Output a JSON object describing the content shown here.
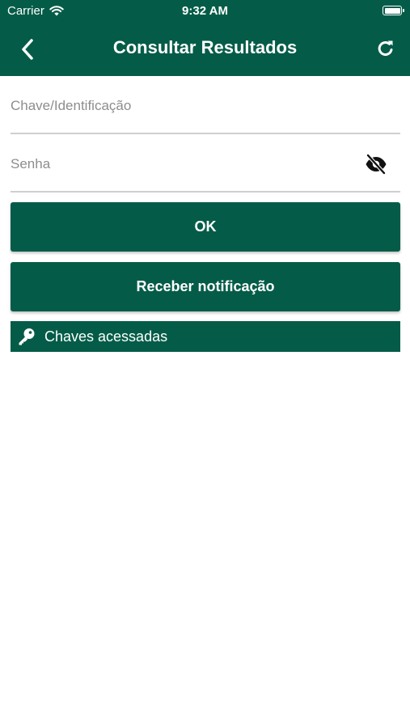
{
  "status_bar": {
    "carrier": "Carrier",
    "time": "9:32 AM"
  },
  "header": {
    "title": "Consultar Resultados",
    "back_icon": "chevron-left-icon",
    "refresh_icon": "refresh-icon"
  },
  "form": {
    "key_placeholder": "Chave/Identificação",
    "key_value": "",
    "password_placeholder": "Senha",
    "password_value": "",
    "visibility_icon": "eye-off-icon"
  },
  "buttons": {
    "ok_label": "OK",
    "notify_label": "Receber notificação"
  },
  "accessed_keys": {
    "label": "Chaves acessadas",
    "icon": "key-icon"
  },
  "colors": {
    "primary": "#045c48",
    "background": "#ffffff",
    "placeholder": "#8d8d8d",
    "divider": "#cfcfcf"
  }
}
